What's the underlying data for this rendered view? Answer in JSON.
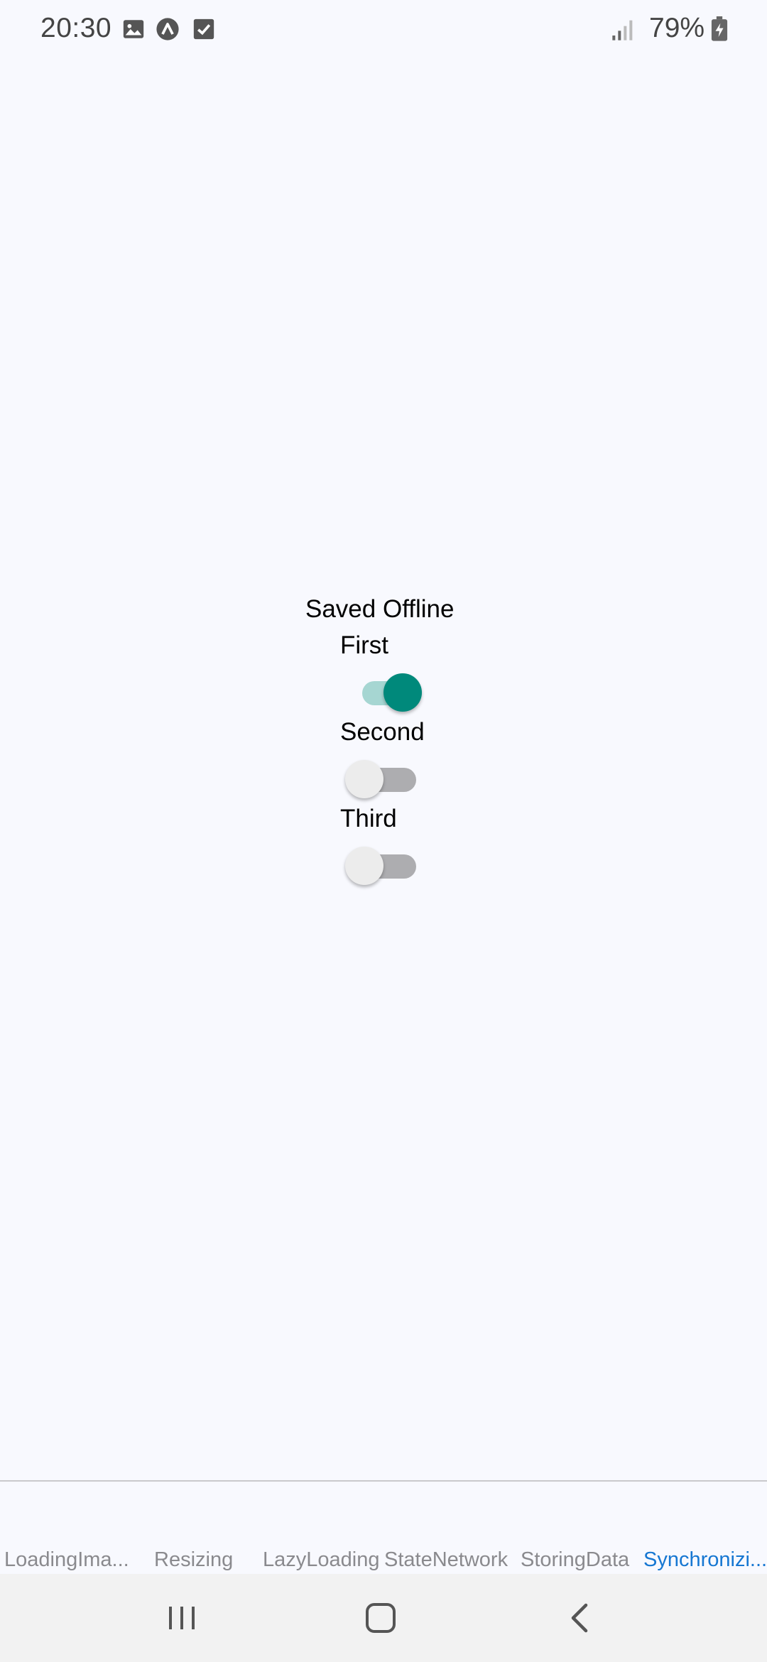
{
  "status_bar": {
    "time": "20:30",
    "battery": "79%",
    "icons": [
      "gallery-icon",
      "a-circle-icon",
      "check-box-icon",
      "signal-icon",
      "battery-charging-icon"
    ]
  },
  "main": {
    "title": "Saved Offline",
    "toggles": [
      {
        "label": "First",
        "on": true
      },
      {
        "label": "Second",
        "on": false
      },
      {
        "label": "Third",
        "on": false
      }
    ]
  },
  "tabs": [
    {
      "label": "LoadingIma..."
    },
    {
      "label": "Resizing"
    },
    {
      "label": "LazyLoading"
    },
    {
      "label": "StateNetwork"
    },
    {
      "label": "StoringData"
    },
    {
      "label": "Synchronizi...",
      "active": true
    }
  ],
  "colors": {
    "background": "#F8F9FE",
    "accent": "#00897B",
    "accent_track": "#A6D6D2",
    "active_tab": "#1677D2"
  },
  "navbar": {
    "icons": [
      "recents-icon",
      "home-icon",
      "back-icon"
    ]
  }
}
